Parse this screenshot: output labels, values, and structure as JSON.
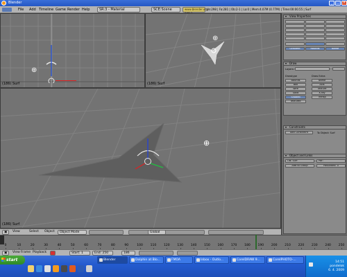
{
  "window": {
    "title": "Blender"
  },
  "menu": {
    "items": [
      "File",
      "Add",
      "Timeline",
      "Game",
      "Render",
      "Help"
    ],
    "screen_select": "SR:3 - Material",
    "scene_select": "SCE:Scene",
    "url": "www.blender.org 248.1",
    "stats": "Ve:298 | Fa:281 | Ob:2-1 | La:0 | Mem:4.07M (0.77M) | Time:00:00.55 | Surf"
  },
  "viewports": {
    "top_left": {
      "label": "(186) Surf"
    },
    "top_right": {
      "label": "(186) Surf"
    },
    "main": {
      "label": "(186) Surf"
    }
  },
  "view_header": {
    "items": [
      "View",
      "Select",
      "Object"
    ],
    "mode": "Object Mode",
    "pivot": "Global"
  },
  "panel": {
    "view_properties": {
      "title": "View Properties"
    },
    "buttons_row1": [
      "Gradient",
      "Rounds",
      "Name"
    ],
    "draw": {
      "title": "Draw"
    },
    "layers_label": "Layers:",
    "drawtype_label": "Drawtype",
    "drawextra_label": "Draw Extra",
    "drawtype_opts": [
      "Bounds",
      "Box",
      "Wire",
      "Solid",
      "Shaded",
      "Textured"
    ],
    "drawextra_opts": [
      "Name",
      "Axis",
      "Texture",
      "X-ray",
      "Transp"
    ],
    "constraints": {
      "title": "Constraints"
    },
    "add_constraint": "Add Constraint",
    "to_object": "To Object: Surf",
    "object_links": {
      "title": "Object and Links"
    },
    "ob_name": "OB: Surf",
    "par_field": "Par:",
    "add_group": "Add to Group",
    "pass_index": "PassIndex: 0"
  },
  "timeline": {
    "ticks": [
      "0",
      "10",
      "20",
      "30",
      "40",
      "50",
      "60",
      "70",
      "80",
      "90",
      "100",
      "110",
      "120",
      "130",
      "140",
      "150",
      "160",
      "170",
      "180",
      "190",
      "200",
      "210",
      "220",
      "230",
      "240",
      "250"
    ],
    "current_frame": 186,
    "buttons": [
      "View",
      "Frame",
      "Playback"
    ],
    "start": "Start: 1",
    "end": "End: 250",
    "frame": "186"
  },
  "taskbar": {
    "start_label": "start",
    "tasks": [
      "Blender",
      "Dolphin at Blo...",
      "FMOA",
      "Inbox - Outlo...",
      "CorelDRAW 9...",
      "CorelPHOTO-..."
    ],
    "active_task": "Blender",
    "clock_time": "14:51",
    "clock_day": "pondelok",
    "clock_date": "6. 4. 2009"
  },
  "colors": {
    "accent": "#2457c4",
    "viewport_bg": "#737373",
    "grid": "#858585",
    "selected": "#e8e8e8",
    "axis_x": "#e02020",
    "axis_y": "#20c040",
    "axis_z": "#2040e0"
  }
}
